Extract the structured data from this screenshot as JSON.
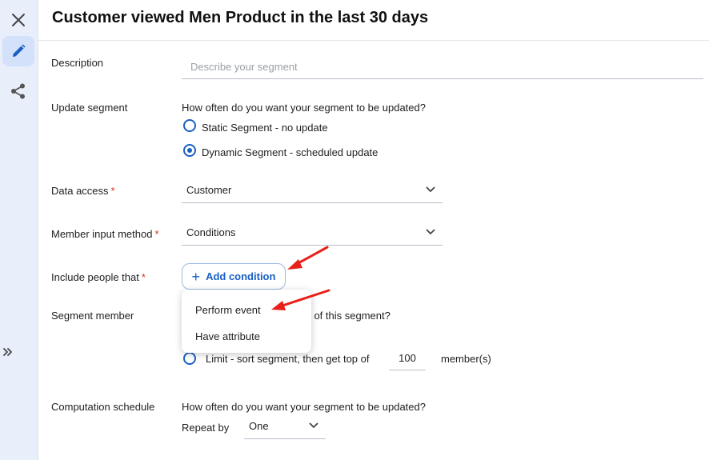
{
  "sidebar": {
    "close_icon": "close-icon",
    "edit_icon": "pencil-icon",
    "share_icon": "share-icon",
    "expand_icon": "double-chevron-right-icon"
  },
  "header": {
    "title": "Customer viewed Men Product in the last 30 days"
  },
  "form": {
    "description": {
      "label": "Description",
      "placeholder": "Describe your segment",
      "value": ""
    },
    "update_segment": {
      "label": "Update segment",
      "prompt": "How often do you want your segment to be updated?",
      "options": [
        "Static Segment - no update",
        "Dynamic Segment - scheduled update"
      ],
      "selected": "Dynamic Segment - scheduled update"
    },
    "data_access": {
      "label": "Data access",
      "required_mark": "*",
      "value": "Customer"
    },
    "member_input_method": {
      "label": "Member input method",
      "required_mark": "*",
      "value": "Conditions"
    },
    "include_people": {
      "label": "Include people that",
      "required_mark": "*",
      "button_label": "Add condition"
    },
    "condition_menu": {
      "items": [
        "Perform event",
        "Have attribute"
      ]
    },
    "segment_member": {
      "label": "Segment member",
      "prompt_visible": "rs of this segment?",
      "limit_text": "Limit - sort segment, then get top of",
      "limit_value": "100",
      "limit_suffix": "member(s)"
    },
    "computation_schedule": {
      "label": "Computation schedule",
      "prompt": "How often do you want your segment to be updated?",
      "repeat_label": "Repeat by",
      "repeat_value": "One"
    }
  },
  "colors": {
    "accent": "#1a5fc4",
    "required": "#d93025",
    "annotation_arrow": "#e8201a",
    "sidebar_bg": "#e8eefa"
  }
}
